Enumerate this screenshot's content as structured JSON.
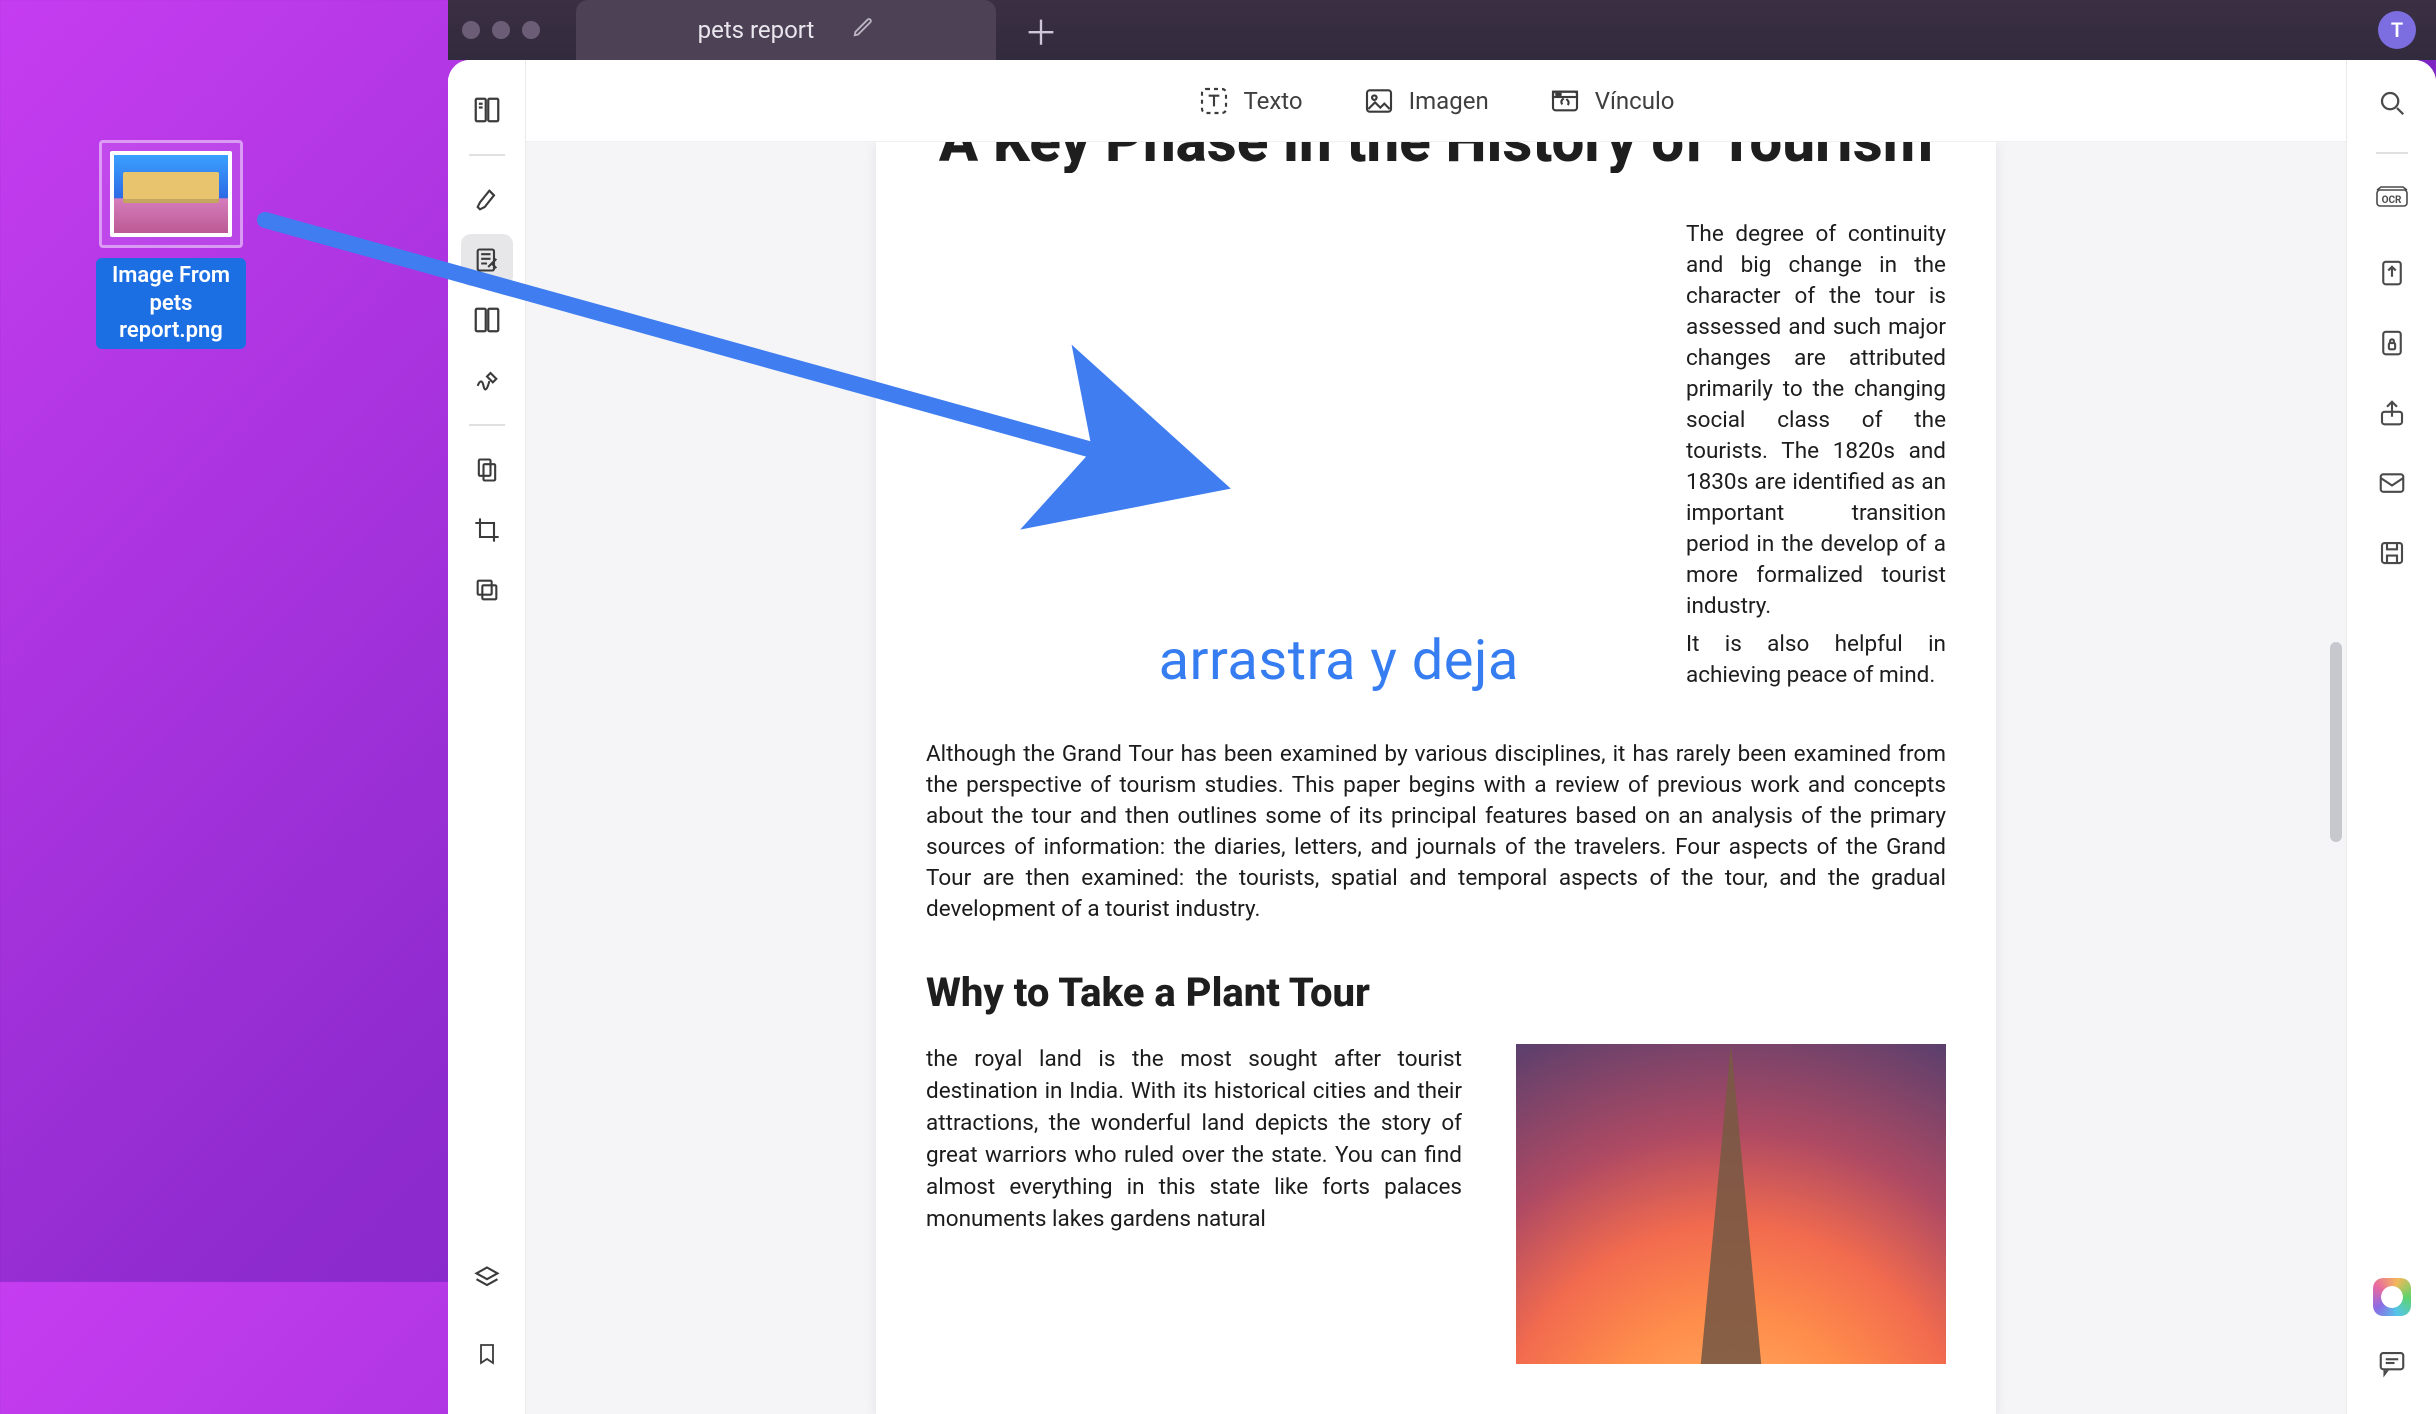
{
  "desktop_file": {
    "label": "Image From pets report.png"
  },
  "window": {
    "tab_title": "pets report",
    "avatar_letter": "T"
  },
  "toolbar": {
    "text_label": "Texto",
    "image_label": "Imagen",
    "link_label": "Vínculo"
  },
  "annotation": {
    "drag_drop_label": "arrastra y deja"
  },
  "document": {
    "heading": "A Key Phase in the History of Tourism",
    "right_col_p1": "The degree of continuity and big change in the character of the tour is assessed and such major changes are attributed primarily to the changing social class of the tourists. The 1820s and 1830s are identified as an important transition period in the develop of a more formalized tourist industry.",
    "right_col_p2": "It is also helpful in achieving peace of mind.",
    "body_p1": "Although the Grand Tour has been examined by various disciplines, it has rarely been examined from the perspective of tourism studies. This paper begins with a review of previous work and concepts about the tour and then outlines some of its principal features based on an analysis of the primary sources of information: the diaries, letters, and journals of the travelers. Four aspects of the Grand Tour are then examined: the tourists, spatial and temporal aspects of the tour, and the gradual development of a tourist industry.",
    "subheading": "Why to Take a Plant Tour",
    "body_p2": "the royal land is the most sought after tourist destination in India. With its historical cities and their attractions, the wonderful land depicts the story of great warriors who ruled over the state. You can find almost everything in this state like forts  palaces  monuments  lakes  gardens  natural"
  },
  "right_rail": {
    "ocr_label": "OCR"
  }
}
